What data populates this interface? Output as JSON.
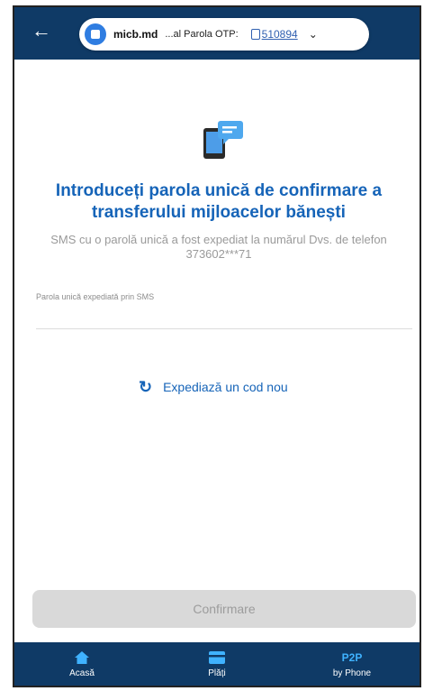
{
  "header": {
    "back_icon": "arrow-left-icon",
    "otp_bar": {
      "domain": "micb.md",
      "label": "...al Parola OTP:",
      "code": "510894",
      "chevron": "chevron-down-icon"
    }
  },
  "main": {
    "icon": "sms-phone-icon",
    "title": "Introduceți parola unică de confirmare a transferului mijloacelor bănești",
    "subtitle": "SMS cu o parolă unică a fost expediat la numărul Dvs. de telefon 373602***71",
    "field": {
      "label": "Parola unică expediată prin SMS",
      "value": ""
    },
    "resend_label": "Expediază un cod nou",
    "confirm_label": "Confirmare"
  },
  "bottom_nav": [
    {
      "icon": "home-icon",
      "label": "Acasă"
    },
    {
      "icon": "card-icon",
      "label": "Plăți"
    },
    {
      "icon_text": "P2P",
      "label": "by Phone"
    }
  ],
  "colors": {
    "brand_dark": "#0f3a66",
    "accent_blue": "#1664b8",
    "disabled_button": "#d9d9d9"
  }
}
